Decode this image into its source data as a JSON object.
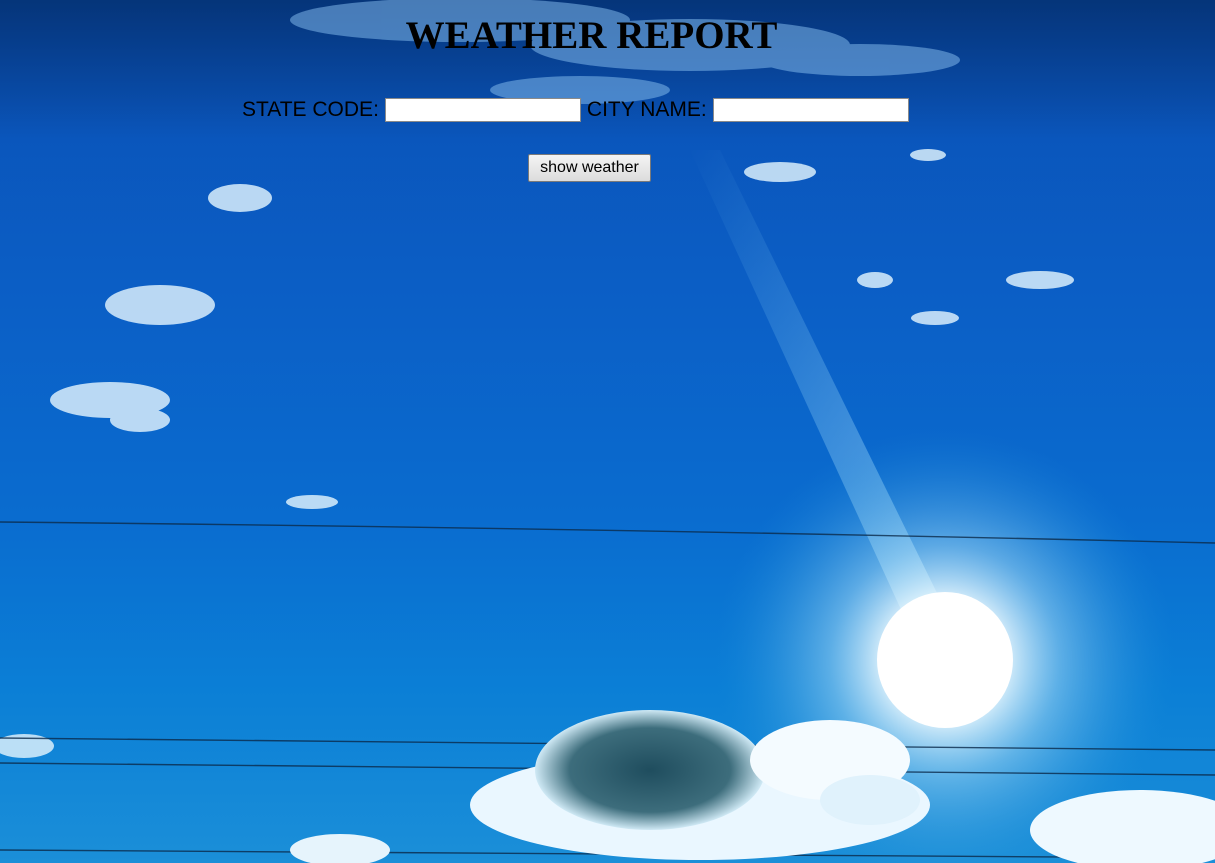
{
  "page": {
    "title": "WEATHER REPORT"
  },
  "form": {
    "state_label": "STATE CODE:",
    "state_value": "",
    "city_label": "CITY NAME:",
    "city_value": "",
    "submit_label": "show weather"
  },
  "colors": {
    "sky_top": "#0a4fb4",
    "sky_bottom": "#1b8fd8",
    "sun": "#ffffff"
  }
}
